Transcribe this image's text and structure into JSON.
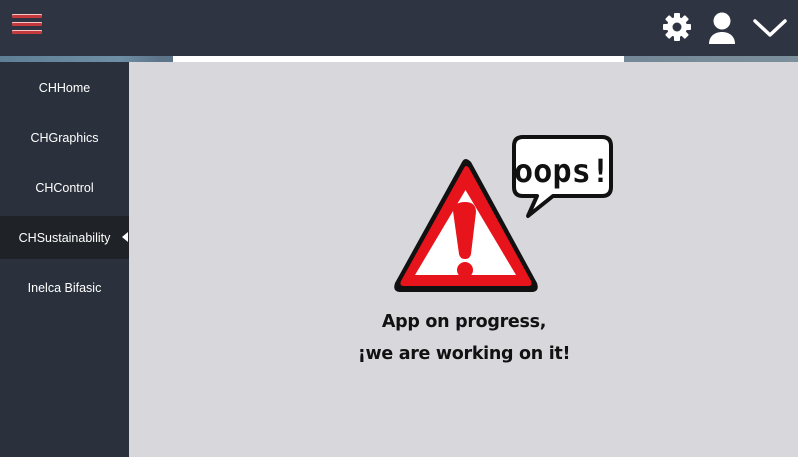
{
  "topbar": {
    "menu_icon": "hamburger-menu-icon",
    "settings_icon": "gear-icon",
    "user_icon": "user-icon",
    "dropdown_icon": "chevron-down-icon",
    "background_color": "#2e3442",
    "menu_color": "#c43a3c"
  },
  "sidebar": {
    "items": [
      {
        "label": "CHHome"
      },
      {
        "label": "CHGraphics"
      },
      {
        "label": "CHControl"
      },
      {
        "label": "CHSustainability",
        "active": true
      },
      {
        "label": "Inelca Bifasic"
      }
    ],
    "background_color": "#2a313d",
    "active_color": "#1f2227"
  },
  "main": {
    "illustration_icon": "warning-triangle-icon",
    "bubble_text": "oops!",
    "message_line1": "App on progress,",
    "message_line2": "¡we are working on it!",
    "background_color": "#d8d7dc",
    "warning_color": "#e8141c"
  }
}
